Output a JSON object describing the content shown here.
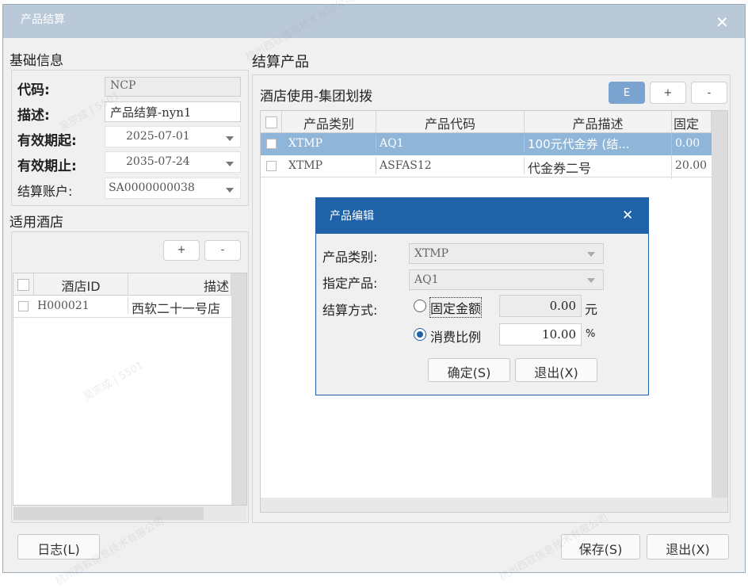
{
  "window": {
    "title": "产品结算"
  },
  "basic": {
    "section_title": "基础信息",
    "code_label": "代码:",
    "code_value": "NCP",
    "desc_label": "描述:",
    "desc_value": "产品结算-nyn1",
    "start_label": "有效期起:",
    "start_value": "2025-07-01",
    "end_label": "有效期止:",
    "end_value": "2035-07-24",
    "account_label": "结算账户:",
    "account_value": "SA0000000038"
  },
  "hotels": {
    "section_title": "适用酒店",
    "add_label": "+",
    "remove_label": "-",
    "columns": [
      "酒店ID",
      "描述"
    ],
    "rows": [
      {
        "id": "H000021",
        "desc": "西软二十一号店"
      }
    ]
  },
  "products": {
    "section_title": "结算产品",
    "group_title": "酒店使用-集团划拨",
    "e_label": "E",
    "add_label": "+",
    "remove_label": "-",
    "columns": [
      "产品类别",
      "产品代码",
      "产品描述",
      "固定"
    ],
    "rows": [
      {
        "category": "XTMP",
        "code": "AQ1",
        "desc": "100元代金券 (结...",
        "fixed": "0.00"
      },
      {
        "category": "XTMP",
        "code": "ASFAS12",
        "desc": "代金券二号",
        "fixed": "20.00"
      }
    ]
  },
  "dialog": {
    "title": "产品编辑",
    "category_label": "产品类别:",
    "category_value": "XTMP",
    "product_label": "指定产品:",
    "product_value": "AQ1",
    "method_label": "结算方式:",
    "fixed_label": "固定金额",
    "fixed_value": "0.00",
    "fixed_unit": "元",
    "ratio_label": "消费比例",
    "ratio_value": "10.00",
    "ratio_unit": "%",
    "ok_label": "确定(S)",
    "exit_label": "退出(X)"
  },
  "footer": {
    "log_label": "日志(L)",
    "save_label": "保存(S)",
    "exit_label": "退出(X)"
  },
  "watermark": [
    "杭州西软信息技术有限公司",
    "吴宗成 | 5501"
  ],
  "colors": {
    "selection": "#8fb6d9",
    "dialog_title": "#1f62a8",
    "title_bar": "#b9c9d8"
  }
}
